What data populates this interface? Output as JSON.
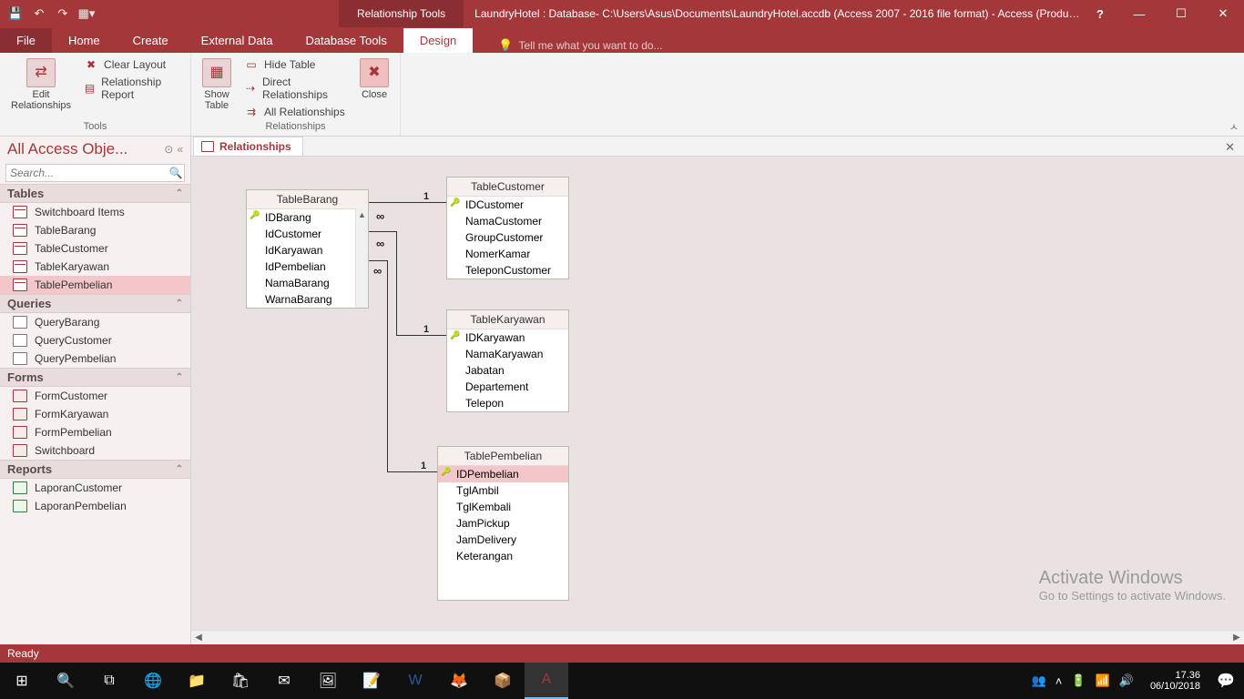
{
  "titlebar": {
    "tools_label": "Relationship Tools",
    "title": "LaundryHotel : Database- C:\\Users\\Asus\\Documents\\LaundryHotel.accdb (Access 2007 - 2016 file format) - Access (Produc..."
  },
  "menubar": {
    "file": "File",
    "tabs": [
      "Home",
      "Create",
      "External Data",
      "Database Tools",
      "Design"
    ],
    "tellme": "Tell me what you want to do..."
  },
  "ribbon": {
    "g1": {
      "btn1": "Edit\nRelationships",
      "clear": "Clear Layout",
      "report": "Relationship Report",
      "label": "Tools"
    },
    "g2": {
      "btn1": "Show\nTable",
      "hide": "Hide Table",
      "direct": "Direct Relationships",
      "all": "All Relationships",
      "close": "Close",
      "label": "Relationships"
    }
  },
  "nav": {
    "title": "All Access Obje...",
    "search": "Search...",
    "groups": {
      "tables": "Tables",
      "queries": "Queries",
      "forms": "Forms",
      "reports": "Reports"
    },
    "tables": [
      "Switchboard Items",
      "TableBarang",
      "TableCustomer",
      "TableKaryawan",
      "TablePembelian"
    ],
    "queries": [
      "QueryBarang",
      "QueryCustomer",
      "QueryPembelian"
    ],
    "forms": [
      "FormCustomer",
      "FormKaryawan",
      "FormPembelian",
      "Switchboard"
    ],
    "reports": [
      "LaporanCustomer",
      "LaporanPembelian"
    ]
  },
  "doctab": "Relationships",
  "rtables": {
    "barang": {
      "title": "TableBarang",
      "fields": [
        "IDBarang",
        "IdCustomer",
        "IdKaryawan",
        "IdPembelian",
        "NamaBarang",
        "WarnaBarang"
      ]
    },
    "customer": {
      "title": "TableCustomer",
      "fields": [
        "IDCustomer",
        "NamaCustomer",
        "GroupCustomer",
        "NomerKamar",
        "TeleponCustomer"
      ]
    },
    "karyawan": {
      "title": "TableKaryawan",
      "fields": [
        "IDKaryawan",
        "NamaKaryawan",
        "Jabatan",
        "Departement",
        "Telepon"
      ]
    },
    "pembelian": {
      "title": "TablePembelian",
      "fields": [
        "IDPembelian",
        "TglAmbil",
        "TglKembali",
        "JamPickup",
        "JamDelivery",
        "Keterangan"
      ]
    }
  },
  "statusbar": "Ready",
  "watermark": {
    "l1": "Activate Windows",
    "l2": "Go to Settings to activate Windows."
  },
  "clock": {
    "time": "17.36",
    "date": "06/10/2018"
  }
}
